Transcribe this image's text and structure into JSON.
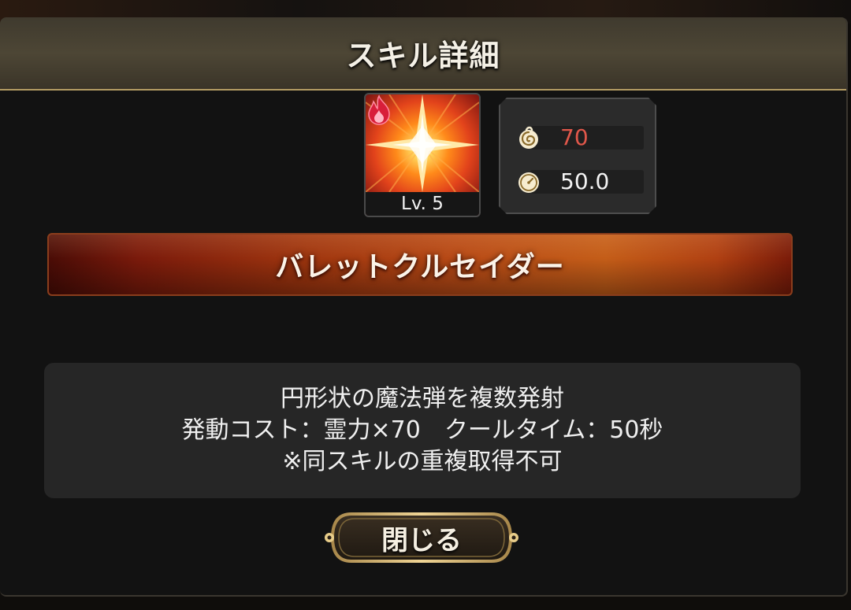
{
  "dialog": {
    "title": "スキル詳細"
  },
  "skill": {
    "level_label": "Lv. 5",
    "element_icon": "fire-element-icon",
    "image_icon": "star-burst-icon",
    "name": "バレットクルセイダー"
  },
  "stats": {
    "cost": {
      "icon": "spirit-swirl-icon",
      "value": "70",
      "color": "#e0574a"
    },
    "cooldown": {
      "icon": "stopwatch-icon",
      "value": "50.0",
      "color": "#f3f3f3"
    }
  },
  "description": {
    "lines": [
      "円形状の魔法弾を複数発射",
      "発動コスト：霊力×70　クールタイム：50秒",
      "※同スキルの重複取得不可"
    ]
  },
  "buttons": {
    "close_label": "閉じる"
  },
  "colors": {
    "title_border": "#b49c63",
    "banner_accent": "#b84a16"
  }
}
